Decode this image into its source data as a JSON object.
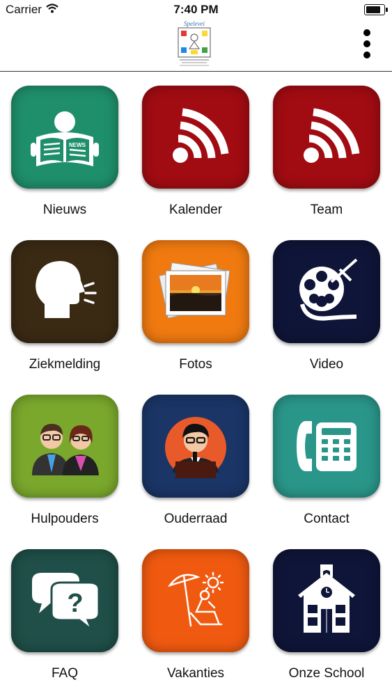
{
  "status_bar": {
    "carrier": "Carrier",
    "time": "7:40 PM",
    "battery_level": 0.9
  },
  "navbar": {
    "logo_text": "Spelevei",
    "more_icon": "more-vertical-icon"
  },
  "tiles": [
    {
      "label": "Nieuws",
      "icon": "newspaper-icon",
      "color": "#1f8f6b"
    },
    {
      "label": "Kalender",
      "icon": "rss-icon",
      "color": "#a10c12"
    },
    {
      "label": "Team",
      "icon": "rss-icon",
      "color": "#a10c12"
    },
    {
      "label": "Ziekmelding",
      "icon": "speaking-head-icon",
      "color": "#3a2a14"
    },
    {
      "label": "Fotos",
      "icon": "photos-icon",
      "color": "#f07a10"
    },
    {
      "label": "Video",
      "icon": "film-reel-icon",
      "color": "#0f1538"
    },
    {
      "label": "Hulpouders",
      "icon": "people-icon",
      "color": "#7aa82c"
    },
    {
      "label": "Ouderraad",
      "icon": "speaker-icon",
      "color": "#1a3566"
    },
    {
      "label": "Contact",
      "icon": "telephone-icon",
      "color": "#2a968a"
    },
    {
      "label": "FAQ",
      "icon": "faq-bubbles-icon",
      "color": "#1f4f48"
    },
    {
      "label": "Vakanties",
      "icon": "vacation-icon",
      "color": "#f05a10"
    },
    {
      "label": "Onze School",
      "icon": "school-building-icon",
      "color": "#0f1538"
    }
  ]
}
